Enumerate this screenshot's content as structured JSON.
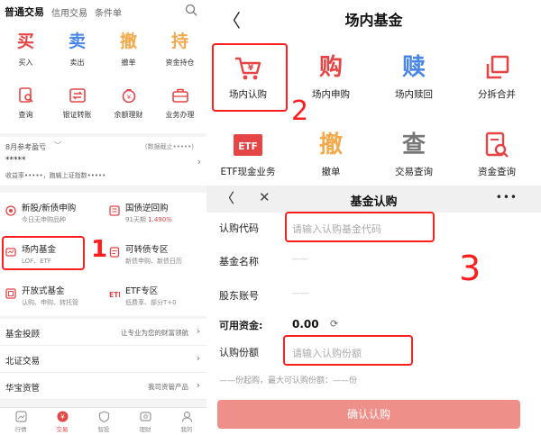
{
  "left": {
    "tabs": [
      "普通交易",
      "信用交易",
      "条件单"
    ],
    "grid": [
      {
        "label": "买入",
        "glyph": "买",
        "color": "#e64545"
      },
      {
        "label": "卖出",
        "glyph": "卖",
        "color": "#4a86e8"
      },
      {
        "label": "撤单",
        "glyph": "撤",
        "color": "#f4a94a"
      },
      {
        "label": "资金持仓",
        "glyph": "持",
        "color": "#f4a94a"
      },
      {
        "label": "查询",
        "icon": "query-icon"
      },
      {
        "label": "银证转账",
        "icon": "transfer-icon"
      },
      {
        "label": "余额理财",
        "icon": "wealth-icon"
      },
      {
        "label": "业务办理",
        "icon": "business-icon"
      }
    ],
    "account": {
      "monthly_summary": "8月参考盈亏",
      "data_date": "(数据截止•••••)",
      "pnl_value": "*****",
      "detail": "收益率•••••，跑输上证指数•••••"
    },
    "products": [
      {
        "title": "新股/新债申购",
        "sub": "今日无申购品种",
        "icon": "ipo-icon"
      },
      {
        "title": "国债逆回购",
        "sub": "91天期",
        "highlight": "1.490%",
        "icon": "repo-icon"
      },
      {
        "title": "场内基金",
        "sub": "LOF、ETF",
        "icon": "fund-icon"
      },
      {
        "title": "可转债专区",
        "sub": "新债申购、新债日历",
        "icon": "bond-icon"
      },
      {
        "title": "开放式基金",
        "sub": "认购、申购、转托管",
        "icon": "open-fund-icon"
      },
      {
        "title": "ETF专区",
        "sub": "低费率、部分T+0",
        "icon": "etf-zone-icon"
      }
    ],
    "rows": [
      {
        "label": "基金投顾",
        "right": "让专业为您的财富领航"
      },
      {
        "label": "北证交易",
        "right": ""
      },
      {
        "label": "华宝资管",
        "right": "我司资管产品"
      }
    ],
    "bottom_nav": [
      "行情",
      "交易",
      "智投",
      "理财",
      "我的"
    ],
    "annotation": "1"
  },
  "right_top": {
    "title": "场内基金",
    "items": [
      {
        "label": "场内认购",
        "icon": "subscribe-cart-icon"
      },
      {
        "label": "场内申购",
        "glyph": "购",
        "color": "#e64545"
      },
      {
        "label": "场内赎回",
        "glyph": "赎",
        "color": "#4a86e8"
      },
      {
        "label": "分拆合并",
        "icon": "split-merge-icon"
      },
      {
        "label": "ETF现金业务",
        "icon": "etf-icon",
        "icon_text": "ETF"
      },
      {
        "label": "撤单",
        "glyph": "撤",
        "color": "#f4a94a"
      },
      {
        "label": "交易查询",
        "glyph": "查",
        "color": "#777777"
      },
      {
        "label": "资金查询",
        "icon": "fund-query-icon"
      }
    ],
    "annotation": "2"
  },
  "right_bottom": {
    "title": "基金认购",
    "more": "•••",
    "fields": {
      "code_label": "认购代码",
      "code_placeholder": "请输入认购基金代码",
      "name_label": "基金名称",
      "name_value": "——",
      "holder_label": "股东账号",
      "holder_value": "——",
      "funds_label": "可用资金:",
      "funds_value": "0.00",
      "qty_label": "认购份额",
      "qty_placeholder": "请输入认购份额"
    },
    "note": "——份起购，最大可认购份额：——份",
    "confirm": "确认认购",
    "annotation": "3"
  },
  "colors": {
    "brand_red": "#e64545",
    "annotation_red": "#ff1d1d",
    "confirm_bg": "#ef8f8a"
  }
}
